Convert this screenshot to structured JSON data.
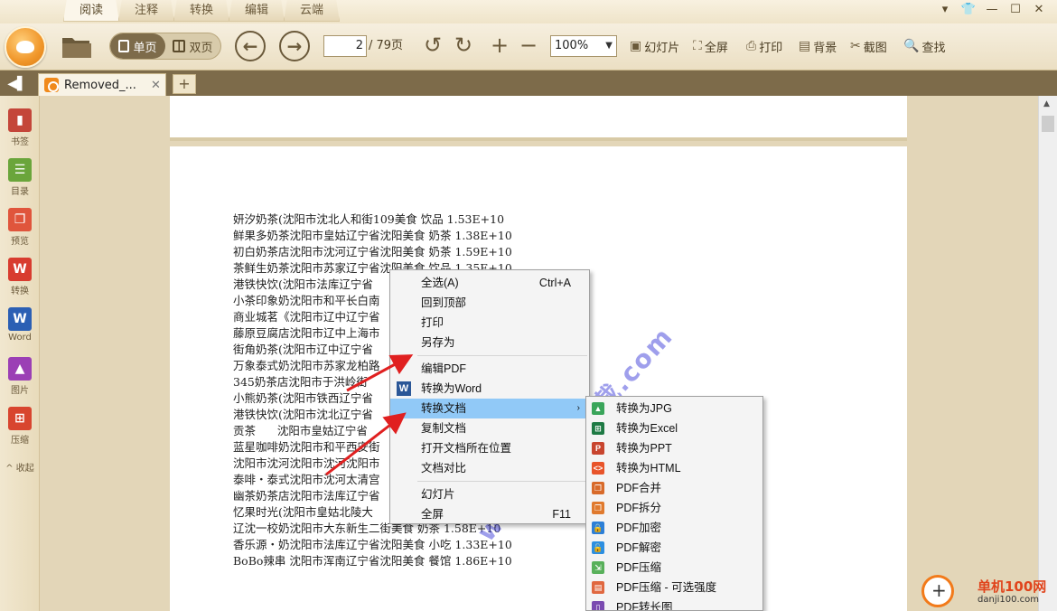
{
  "menu_tabs": [
    "阅读",
    "注释",
    "转换",
    "编辑",
    "云端"
  ],
  "toolbar": {
    "single_page": "单页",
    "double_page": "双页",
    "current_page": "2",
    "total_pages": "/ 79页",
    "zoom": "100%",
    "slideshow": "幻灯片",
    "fullscreen": "全屏",
    "print": "打印",
    "background": "背景",
    "screenshot": "截图",
    "find": "查找"
  },
  "doc_tab": {
    "title": "Removed_...",
    "close": "✕",
    "new": "+"
  },
  "sidebar": {
    "items": [
      {
        "label": "书签",
        "color": "#c4463a",
        "icon": "bookmark-icon"
      },
      {
        "label": "目录",
        "color": "#6aa53b",
        "icon": "toc-icon"
      },
      {
        "label": "预览",
        "color": "#e0553c",
        "icon": "preview-icon"
      },
      {
        "label": "转换",
        "color": "#d83c2f",
        "icon": "convert-icon"
      },
      {
        "label": "Word",
        "color": "#2b5fb4",
        "icon": "word-icon"
      },
      {
        "label": "图片",
        "color": "#9b3fb5",
        "icon": "image-icon"
      },
      {
        "label": "压缩",
        "color": "#d8452f",
        "icon": "compress-icon"
      }
    ],
    "collapse": "^ 收起"
  },
  "document": {
    "lines": [
      "妍汐奶茶(沈阳市沈北人和街109美食 饮品 1.53E+10",
      "鲜果多奶茶沈阳市皇姑辽宁省沈阳美食 奶茶 1.38E+10",
      "初白奶茶店沈阳市沈河辽宁省沈阳美食 奶茶 1.59E+10",
      "茶鲜生奶茶沈阳市苏家辽宁省沈阳美食 饮品 1.35E+10",
      "港铁快饮(沈阳市法库辽宁省",
      "小茶印象奶沈阳市和平长白南",
      "商业城茗《沈阳市辽中辽宁省",
      "藤原豆腐店沈阳市辽中上海市",
      "街角奶茶(沈阳市辽中辽宁省",
      "万象泰式奶沈阳市苏家龙柏路",
      "345奶茶店沈阳市于洪岭街",
      "小熊奶茶(沈阳市铁西辽宁省",
      "港铁快饮(沈阳市沈北辽宁省",
      "贡茶      沈阳市皇姑辽宁省",
      "蓝星咖啡奶沈阳市和平西安街",
      "沈阳市沈河沈阳市沈河沈阳市",
      "泰啡・泰式沈阳市沈河太清宫",
      "幽茶奶茶店沈阳市法库辽宁省",
      "忆果时光(沈阳市皇姑北陵大",
      "辽沈一校奶沈阳市大东新生二街美食 奶茶 1.58E+10",
      "香乐源・奶沈阳市法库辽宁省沈阳美食 小吃 1.33E+10",
      "BoBo辣串 沈阳市浑南辽宁省沈阳美食 餐馆 1.86E+10"
    ],
    "watermark": "www.PDF下载.com"
  },
  "context_menu": {
    "items": [
      {
        "label": "全选(A)",
        "shortcut": "Ctrl+A"
      },
      {
        "label": "回到顶部"
      },
      {
        "label": "打印"
      },
      {
        "label": "另存为"
      },
      {
        "label": "编辑PDF"
      },
      {
        "label": "转换为Word"
      },
      {
        "label": "转换文档"
      },
      {
        "label": "复制文档"
      },
      {
        "label": "打开文档所在位置"
      },
      {
        "label": "文档对比"
      },
      {
        "label": "幻灯片"
      },
      {
        "label": "全屏",
        "shortcut": "F11"
      }
    ]
  },
  "submenu": {
    "items": [
      {
        "label": "转换为JPG",
        "color": "#3aa55a"
      },
      {
        "label": "转换为Excel",
        "color": "#1e7a44"
      },
      {
        "label": "转换为PPT",
        "color": "#c8452e"
      },
      {
        "label": "转换为HTML",
        "color": "#e8542a"
      },
      {
        "label": "PDF合并",
        "color": "#d86a2a"
      },
      {
        "label": "PDF拆分",
        "color": "#e07a2e"
      },
      {
        "label": "PDF加密",
        "color": "#2d7fd6"
      },
      {
        "label": "PDF解密",
        "color": "#2d8fe0"
      },
      {
        "label": "PDF压缩",
        "color": "#58b05a"
      },
      {
        "label": "PDF压缩 - 可选强度",
        "color": "#e06840"
      },
      {
        "label": "PDF转长图",
        "color": "#7a4ab0"
      }
    ]
  },
  "site_badge": {
    "title": "单机100网",
    "url": "danji100.com"
  }
}
